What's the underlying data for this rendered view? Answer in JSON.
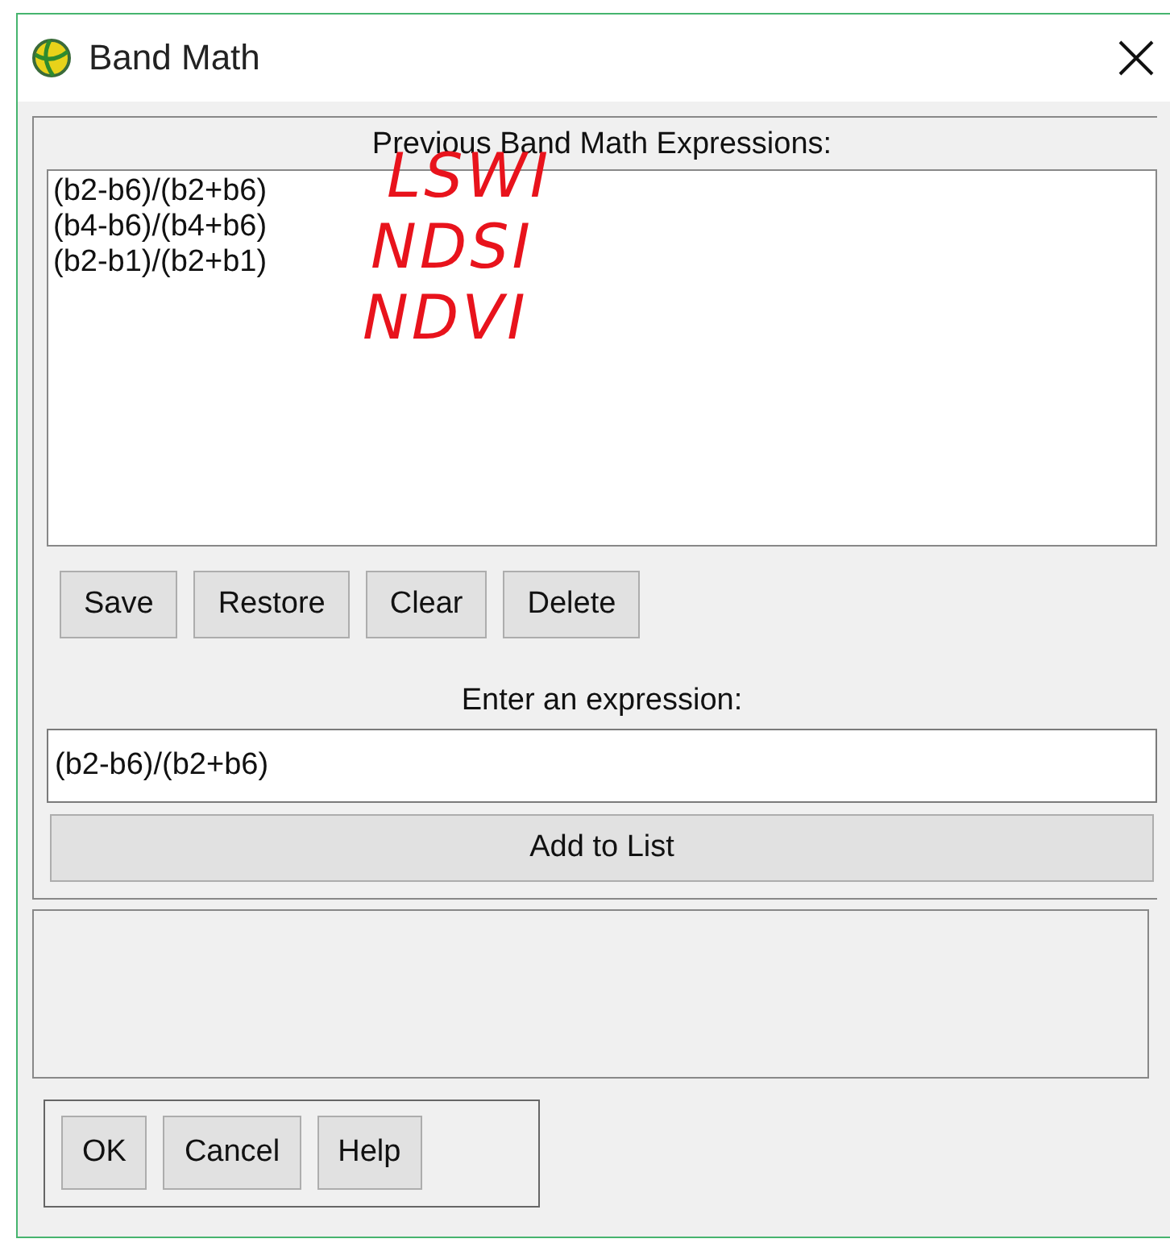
{
  "window": {
    "title": "Band Math"
  },
  "previous_expressions": {
    "label": "Previous Band Math Expressions:",
    "items": [
      {
        "text": "(b2-b6)/(b2+b6)",
        "selected": false
      },
      {
        "text": "(b4-b6)/(b4+b6)",
        "selected": false
      },
      {
        "text": "(b2-b1)/(b2+b1)",
        "selected": false
      }
    ],
    "annotations": [
      "LSWI",
      "NDSI",
      "NDVI"
    ]
  },
  "list_buttons": [
    "Save",
    "Restore",
    "Clear",
    "Delete"
  ],
  "expression": {
    "label": "Enter an expression:",
    "value": "(b2-b6)/(b2+b6)"
  },
  "add_button": "Add to List",
  "dialog_buttons": [
    "OK",
    "Cancel",
    "Help"
  ]
}
